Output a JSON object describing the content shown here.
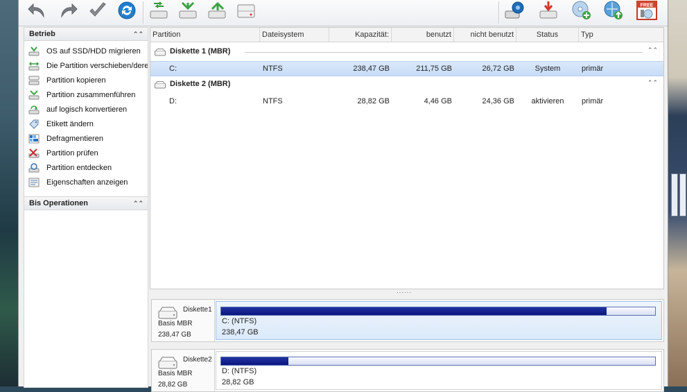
{
  "toolbar": {
    "buttons": [
      {
        "icon": "undo-icon"
      },
      {
        "icon": "redo-icon"
      },
      {
        "icon": "apply-checkmark-icon"
      },
      {
        "icon": "refresh-icon"
      },
      {
        "icon": "disk-copy-icon"
      },
      {
        "icon": "disk-wizard-icon"
      },
      {
        "icon": "disk-migrate-icon"
      },
      {
        "icon": "disk-icon"
      },
      {
        "icon": "disk-search-icon"
      },
      {
        "icon": "disk-upgrade-icon"
      },
      {
        "icon": "cd-add-icon"
      },
      {
        "icon": "network-upload-icon"
      },
      {
        "icon": "free-badge-icon",
        "text": "FREE"
      }
    ]
  },
  "sidebar": {
    "operations_header": "Betrieb",
    "items": [
      {
        "label": "OS auf SSD/HDD migrieren",
        "icon": "migrate-icon"
      },
      {
        "label": "Die Partition verschieben/dere",
        "icon": "move-partition-icon"
      },
      {
        "label": "Partition kopieren",
        "icon": "copy-partition-icon"
      },
      {
        "label": "Partition zusammenführen",
        "icon": "merge-partition-icon"
      },
      {
        "label": "auf logisch konvertieren",
        "icon": "convert-logical-icon"
      },
      {
        "label": "Etikett ändern",
        "icon": "label-icon"
      },
      {
        "label": "Defragmentieren",
        "icon": "defragment-icon"
      },
      {
        "label": "Partition prüfen",
        "icon": "check-partition-icon"
      },
      {
        "label": "Partition entdecken",
        "icon": "explore-partition-icon"
      },
      {
        "label": "Eigenschaften anzeigen",
        "icon": "properties-icon"
      }
    ],
    "pending_header": "Bis Operationen"
  },
  "table": {
    "columns": [
      "Partition",
      "Dateisystem",
      "Kapazität:",
      "benutzt",
      "nicht benutzt",
      "Status",
      "Typ"
    ],
    "disks": [
      {
        "label": "Diskette 1 (MBR)",
        "partitions": [
          {
            "partition": "C:",
            "filesystem": "NTFS",
            "capacity": "238,47 GB",
            "used": "211,75 GB",
            "unused": "26,72 GB",
            "status": "System",
            "type": "primär",
            "selected": true
          }
        ]
      },
      {
        "label": "Diskette 2 (MBR)",
        "partitions": [
          {
            "partition": "D:",
            "filesystem": "NTFS",
            "capacity": "28,82 GB",
            "used": "4,46 GB",
            "unused": "24,36 GB",
            "status": "aktivieren",
            "type": "primär",
            "selected": false
          }
        ]
      }
    ]
  },
  "diskmap": [
    {
      "name": "Diskette1",
      "type": "Basis MBR",
      "size": "238,47 GB",
      "part_label": "C: (NTFS)",
      "part_size": "238,47 GB",
      "used_fraction": 0.888,
      "selected": true
    },
    {
      "name": "Diskette2",
      "type": "Basis MBR",
      "size": "28,82 GB",
      "part_label": "D: (NTFS)",
      "part_size": "28,82 GB",
      "used_fraction": 0.155,
      "selected": false
    }
  ],
  "colors": {
    "selection": "#c6dcf7",
    "usage_bar": "#0a1680"
  }
}
